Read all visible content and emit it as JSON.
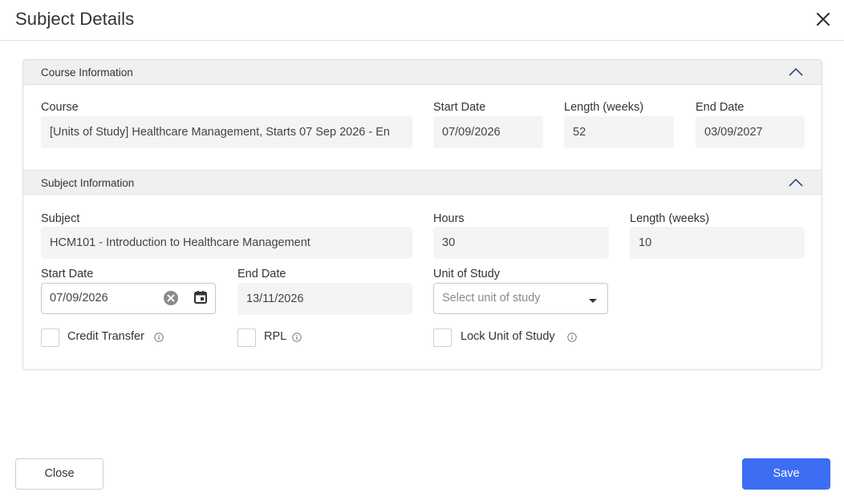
{
  "dialog": {
    "title": "Subject Details",
    "close_icon": "close-icon"
  },
  "course_section": {
    "title": "Course Information",
    "collapse_icon": "chevron-up-icon",
    "course_label": "Course",
    "course_value": "[Units of Study] Healthcare Management, Starts 07 Sep 2026 - En",
    "start_date_label": "Start Date",
    "start_date_value": "07/09/2026",
    "length_label": "Length (weeks)",
    "length_value": "52",
    "end_date_label": "End Date",
    "end_date_value": "03/09/2027"
  },
  "subject_section": {
    "title": "Subject Information",
    "collapse_icon": "chevron-up-icon",
    "subject_label": "Subject",
    "subject_value": "HCM101 - Introduction to Healthcare Management",
    "hours_label": "Hours",
    "hours_value": "30",
    "length_label": "Length (weeks)",
    "length_value": "10",
    "start_date_label": "Start Date",
    "start_date_value": "07/09/2026",
    "end_date_label": "End Date",
    "end_date_value": "13/11/2026",
    "unit_label": "Unit of Study",
    "unit_placeholder": "Select unit of study",
    "credit_transfer_label": "Credit Transfer",
    "rpl_label": "RPL",
    "lock_unit_label": "Lock Unit of Study",
    "credit_transfer_checked": false,
    "rpl_checked": false,
    "lock_unit_checked": false
  },
  "footer": {
    "close_label": "Close",
    "save_label": "Save"
  },
  "colors": {
    "primary": "#3d6df2",
    "section_bg": "#f0f0f0",
    "field_bg": "#f4f4f4"
  }
}
